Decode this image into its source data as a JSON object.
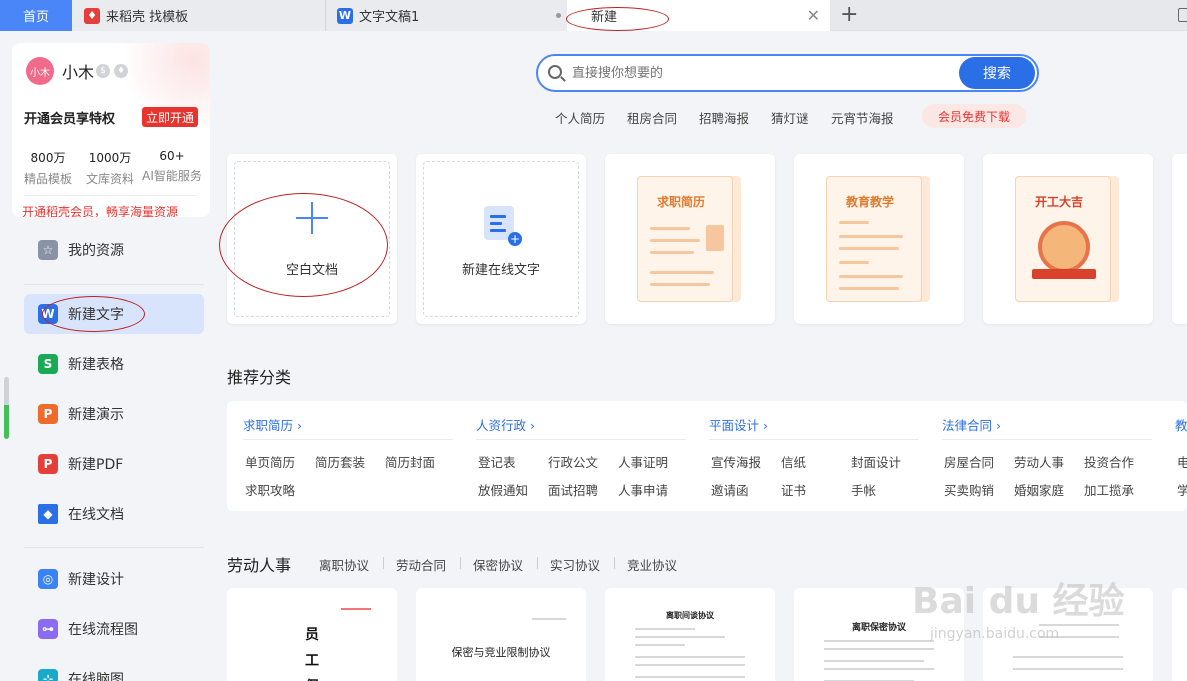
{
  "tabs": {
    "home": "首页",
    "daoke": "来稻壳 找模板",
    "doc": "文字文稿1",
    "new": "新建"
  },
  "user": {
    "avatar": "小木",
    "name": "小木",
    "vip_title": "开通会员享特权",
    "vip_button": "立即开通",
    "stats": [
      {
        "num": "800万",
        "label": "精品模板"
      },
      {
        "num": "1000万",
        "label": "文库资料"
      },
      {
        "num": "60+",
        "label": "AI智能服务"
      }
    ],
    "vip_link": "开通稻壳会员，畅享海量资源"
  },
  "nav": {
    "resources": "我的资源",
    "new_text": "新建文字",
    "new_sheet": "新建表格",
    "new_ppt": "新建演示",
    "new_pdf": "新建PDF",
    "online_doc": "在线文档",
    "new_design": "新建设计",
    "flowchart": "在线流程图",
    "mindmap": "在线脑图"
  },
  "search": {
    "placeholder": "直接搜你想要的",
    "button": "搜索"
  },
  "hot_tags": [
    "个人简历",
    "租房合同",
    "招聘海报",
    "猜灯谜",
    "元宵节海报"
  ],
  "hot_vip": "会员免费下载",
  "cards": {
    "blank": "空白文档",
    "online": "新建在线文字",
    "resume": "求职简历",
    "teach": "教育教学",
    "lucky": "开工大吉"
  },
  "recommend": {
    "title": "推荐分类",
    "columns": [
      {
        "head": "求职简历",
        "items": [
          "单页简历",
          "简历套装",
          "简历封面",
          "求职攻略"
        ]
      },
      {
        "head": "人资行政",
        "items": [
          "登记表",
          "行政公文",
          "人事证明",
          "放假通知",
          "面试招聘",
          "人事申请"
        ]
      },
      {
        "head": "平面设计",
        "items": [
          "宣传海报",
          "信纸",
          "封面设计",
          "邀请函",
          "证书",
          "手帐"
        ]
      },
      {
        "head": "法律合同",
        "items": [
          "房屋合同",
          "劳动人事",
          "投资合作",
          "买卖购销",
          "婚姻家庭",
          "加工揽承"
        ]
      },
      {
        "head": "教",
        "items": [
          "电",
          "学"
        ]
      }
    ]
  },
  "labor": {
    "title": "劳动人事",
    "tabs": [
      "离职协议",
      "劳动合同",
      "保密协议",
      "实习协议",
      "竞业协议"
    ],
    "docs": [
      "员工保",
      "保密与竞业限制协议",
      "离职间谈协议",
      "离职保密协议"
    ]
  },
  "watermark": {
    "brand": "Bai du 经验",
    "url": "jingyan.baidu.com"
  }
}
